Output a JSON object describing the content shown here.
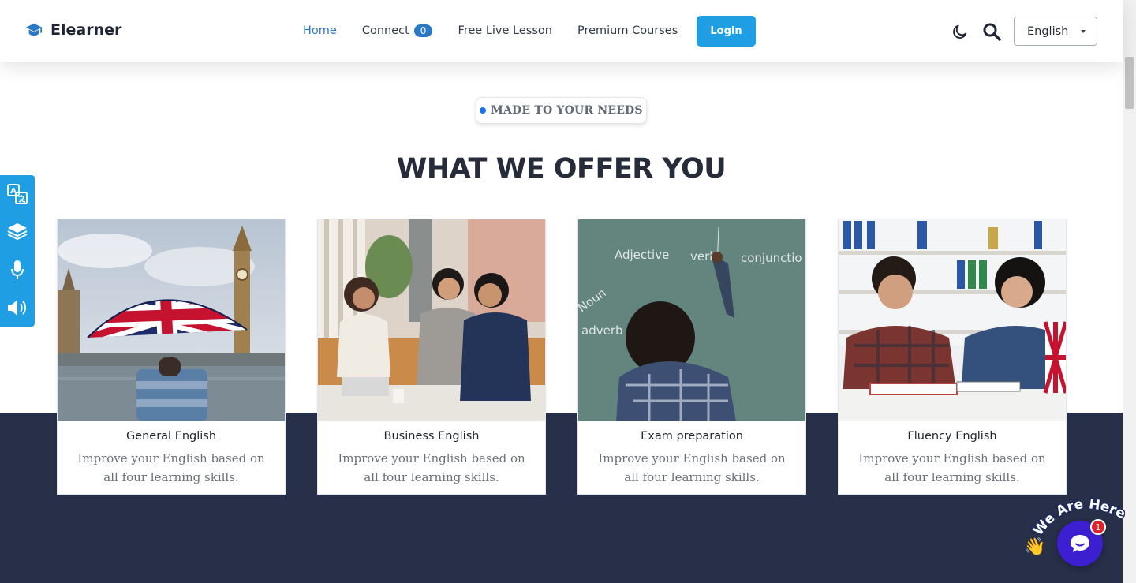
{
  "header": {
    "brand": "Elearner",
    "nav": {
      "home": "Home",
      "connect": "Connect",
      "connect_badge": "0",
      "free_live_lesson": "Free Live Lesson",
      "premium_courses": "Premium Courses"
    },
    "login_label": "Login",
    "language": "English",
    "icons": {
      "theme": "moon-icon",
      "search": "search-icon"
    }
  },
  "section": {
    "eyebrow": "MADE TO YOUR NEEDS",
    "title": "WHAT WE OFFER YOU"
  },
  "side_toolbar": [
    "translate-icon",
    "layers-icon",
    "microphone-icon",
    "speaker-icon"
  ],
  "cards": [
    {
      "title": "General English",
      "description": "Improve your English based on all four learning skills."
    },
    {
      "title": "Business English",
      "description": "Improve your English based on all four learning skills."
    },
    {
      "title": "Exam preparation",
      "description": "Improve your English based on all four learning skills."
    },
    {
      "title": "Fluency English",
      "description": "Improve your English based on all four learning skills."
    }
  ],
  "chalkboard_words": [
    "Adjective",
    "verb",
    "conjunctio",
    "Noun",
    "adverb"
  ],
  "chat": {
    "label": "We Are Here!",
    "badge": "1"
  },
  "colors": {
    "accent": "#1f9ee3",
    "nav_active": "#2a78c8",
    "band": "#272f49",
    "chat": "#3b1fd0"
  }
}
